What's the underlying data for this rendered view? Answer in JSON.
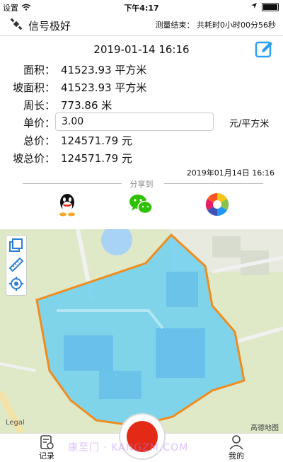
{
  "status_bar": {
    "left_label": "设置",
    "time": "下午4:17"
  },
  "header": {
    "app_name": "信号极好",
    "measure_status": "测量结束： 共耗时0小时00分56秒"
  },
  "record": {
    "datetime": "2019-01-14 16:16",
    "area_label": "面积：",
    "area_value": "41523.93 平方米",
    "slope_area_label": "坡面积：",
    "slope_area_value": "41523.93 平方米",
    "perimeter_label": "周长：",
    "perimeter_value": "773.86 米",
    "unit_price_label": "单价：",
    "unit_price_value": "3.00",
    "unit_price_unit": "元/平方米",
    "total_label": "总价：",
    "total_value": "124571.79 元",
    "slope_total_label": "坡总价：",
    "slope_total_value": "124571.79 元",
    "stamp": "2019年01月14日 16:16"
  },
  "share": {
    "label": "分享到",
    "targets": [
      "qq-icon",
      "wechat-icon",
      "moments-icon"
    ]
  },
  "map": {
    "legal": "Legal",
    "provider": "高德地图",
    "polygon_color": "#f08c1e",
    "fill_color": "#6fd0f0"
  },
  "bottom_nav": {
    "records_label": "记录",
    "mine_label": "我的",
    "record_color": "#e32a17"
  },
  "watermark": "康至门 · KANGZM.COM"
}
